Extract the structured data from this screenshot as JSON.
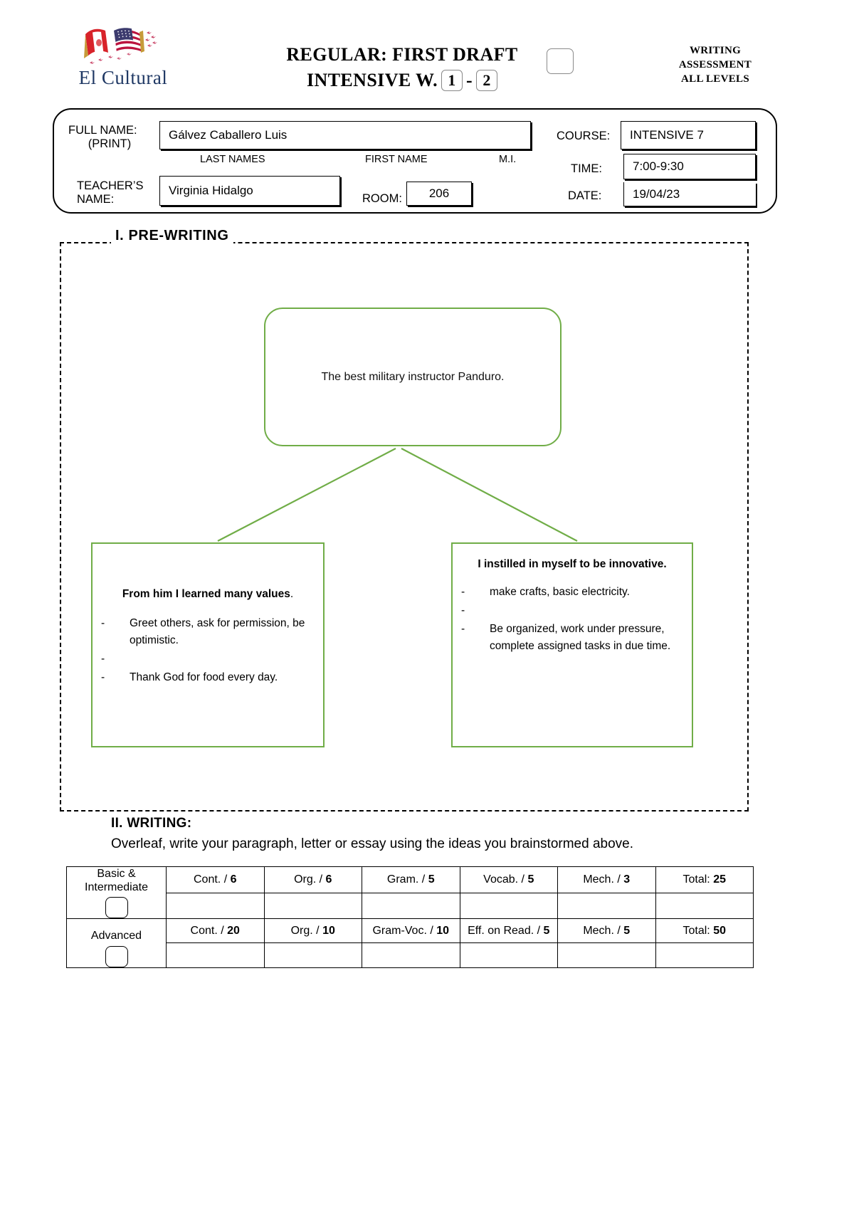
{
  "header": {
    "logo_name": "El Cultural",
    "logo_icon": "peru-usa-flags-icon",
    "title_line1": "REGULAR: FIRST DRAFT",
    "title_line2_label": "INTENSIVE W.",
    "week_from": "1",
    "week_sep": "-",
    "week_to": "2",
    "right_line1": "WRITING",
    "right_line2": "ASSESSMENT",
    "right_line3": "ALL LEVELS"
  },
  "info": {
    "full_name_label": "FULL NAME:",
    "print_label": "(PRINT)",
    "full_name_value": "Gálvez Caballero Luis",
    "caption_last": "LAST NAMES",
    "caption_first": "FIRST NAME",
    "caption_mi": "M.I.",
    "teacher_label_line1": "TEACHER’S",
    "teacher_label_line2": "NAME:",
    "teacher_value": "Virginia Hidalgo",
    "room_label": "ROOM:",
    "room_value": "206",
    "course_label": "COURSE:",
    "course_value": "INTENSIVE 7",
    "time_label": "TIME:",
    "time_value": "7:00-9:30",
    "date_label": "DATE:",
    "date_value": "19/04/23"
  },
  "section1": {
    "title": "I.  PRE-WRITING",
    "accent_color": "#70AD47",
    "top_node": "The best military instructor Panduro.",
    "left_node": {
      "heading": "From him I learned many values",
      "heading_suffix": ".",
      "bullets": [
        {
          "marker": "-",
          "text": "Greet others, ask for permission, be optimistic."
        },
        {
          "marker": "-",
          "text": ""
        },
        {
          "marker": "-",
          "text": "Thank God for food every day."
        }
      ]
    },
    "right_node": {
      "heading": "I instilled in myself to be innovative.",
      "heading_suffix": "",
      "bullets": [
        {
          "marker": "-",
          "text": "make crafts, basic electricity."
        },
        {
          "marker": "-",
          "text": ""
        },
        {
          "marker": "-",
          "text": "Be organized, work under pressure, complete assigned tasks in due time."
        }
      ]
    }
  },
  "section2": {
    "title": "II. WRITING:",
    "subtitle": "Overleaf, write your paragraph, letter or essay using the ideas you brainstormed above."
  },
  "score_table": {
    "rows": [
      {
        "label_line1": "Basic &",
        "label_line2": "Intermediate",
        "columns": [
          {
            "name": "Cont. /",
            "max": "6"
          },
          {
            "name": "Org. /",
            "max": "6"
          },
          {
            "name": "Gram. /",
            "max": "5"
          },
          {
            "name": "Vocab. /",
            "max": "5"
          },
          {
            "name": "Mech. /",
            "max": "3"
          },
          {
            "name": "Total:",
            "max": "25"
          }
        ],
        "values": [
          "",
          "",
          "",
          "",
          "",
          ""
        ]
      },
      {
        "label_line1": "Advanced",
        "label_line2": "",
        "columns": [
          {
            "name": "Cont. /",
            "max": "20"
          },
          {
            "name": "Org. /",
            "max": "10"
          },
          {
            "name": "Gram-Voc. /",
            "max": "10"
          },
          {
            "name": "Eff. on Read. /",
            "max": "5"
          },
          {
            "name": "Mech. /",
            "max": "5"
          },
          {
            "name": "Total:",
            "max": "50"
          }
        ],
        "values": [
          "",
          "",
          "",
          "",
          "",
          ""
        ]
      }
    ]
  }
}
